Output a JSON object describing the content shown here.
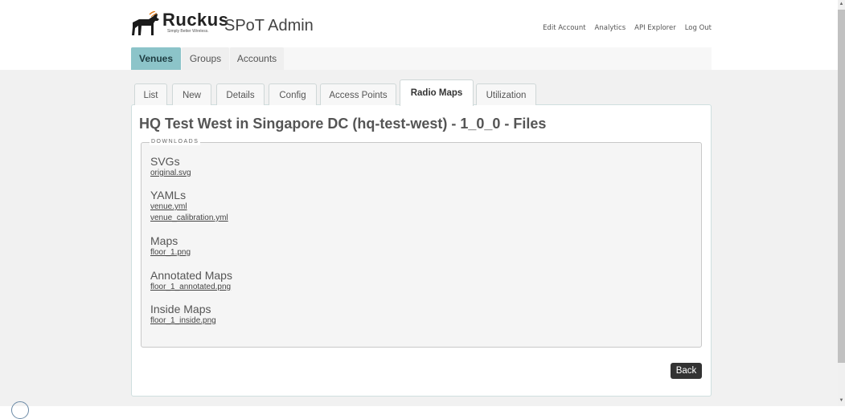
{
  "brand": {
    "name": "Ruckus",
    "tagline": "Simply Better Wireless.",
    "logo_icon": "dog-logo-icon"
  },
  "app_title": "SPoT Admin",
  "top_links": [
    "Edit Account",
    "Analytics",
    "API Explorer",
    "Log Out"
  ],
  "main_nav": {
    "items": [
      "Venues",
      "Groups",
      "Accounts"
    ],
    "active": "Venues"
  },
  "sub_tabs": {
    "items": [
      "List",
      "New",
      "Details",
      "Config",
      "Access Points",
      "Radio Maps",
      "Utilization"
    ],
    "active": "Radio Maps"
  },
  "page_title": "HQ Test West in Singapore DC (hq-test-west) - 1_0_0 - Files",
  "downloads": {
    "legend": "DOWNLOADS",
    "groups": [
      {
        "title": "SVGs",
        "files": [
          "original.svg"
        ]
      },
      {
        "title": "YAMLs",
        "files": [
          "venue.yml",
          "venue_calibration.yml"
        ]
      },
      {
        "title": "Maps",
        "files": [
          "floor_1.png"
        ]
      },
      {
        "title": "Annotated Maps",
        "files": [
          "floor_1_annotated.png"
        ]
      },
      {
        "title": "Inside Maps",
        "files": [
          "floor_1_inside.png"
        ]
      }
    ]
  },
  "back_button": "Back",
  "colors": {
    "accent_tab": "#8cc4c9",
    "panel_border": "#cfdfdf",
    "button_bg": "#333333"
  }
}
